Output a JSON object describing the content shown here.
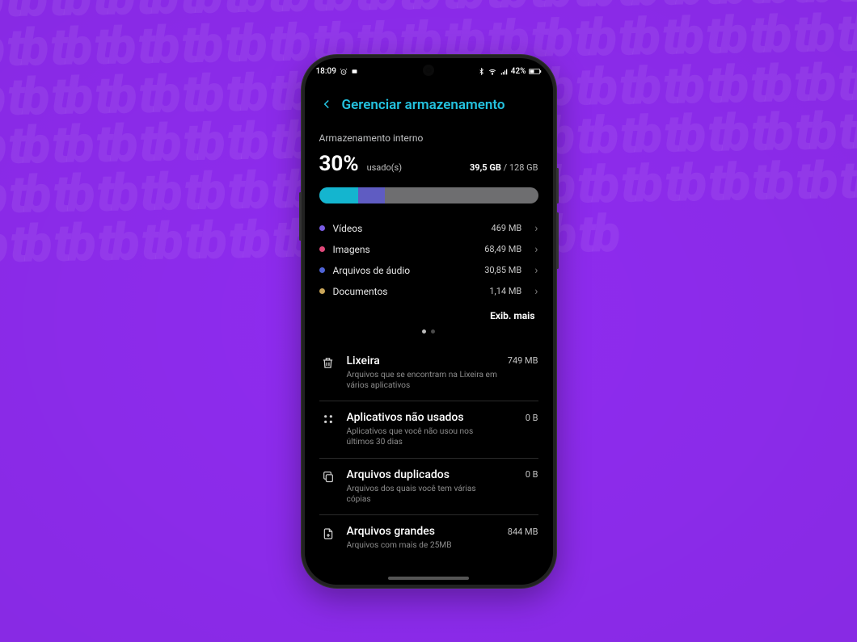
{
  "status_bar": {
    "time": "18:09",
    "battery_text": "42%"
  },
  "header": {
    "title": "Gerenciar armazenamento"
  },
  "storage": {
    "section_label": "Armazenamento interno",
    "percent": "30%",
    "percent_suffix": "usado(s)",
    "used": "39,5 GB",
    "separator": " / ",
    "total": "128 GB",
    "bar_segments": [
      {
        "color": "#14b5cf",
        "width_pct": 18
      },
      {
        "color": "#5f5cc2",
        "width_pct": 12
      }
    ],
    "categories": [
      {
        "dot": "#7a5ce4",
        "name": "Vídeos",
        "size": "469 MB"
      },
      {
        "dot": "#e0487a",
        "name": "Imagens",
        "size": "68,49 MB"
      },
      {
        "dot": "#4f63d6",
        "name": "Arquivos de áudio",
        "size": "30,85 MB"
      },
      {
        "dot": "#caa65a",
        "name": "Documentos",
        "size": "1,14 MB"
      }
    ],
    "show_more_label": "Exib. mais"
  },
  "cleanup_items": [
    {
      "icon": "trash-icon",
      "title": "Lixeira",
      "value": "749 MB",
      "desc": "Arquivos que se encontram na Lixeira em vários aplicativos"
    },
    {
      "icon": "apps-icon",
      "title": "Aplicativos não usados",
      "value": "0 B",
      "desc": "Aplicativos que você não usou nos últimos 30 dias"
    },
    {
      "icon": "duplicate-icon",
      "title": "Arquivos duplicados",
      "value": "0 B",
      "desc": "Arquivos dos quais você tem várias cópias"
    },
    {
      "icon": "large-files-icon",
      "title": "Arquivos grandes",
      "value": "844 MB",
      "desc": "Arquivos com mais de 25MB"
    }
  ]
}
